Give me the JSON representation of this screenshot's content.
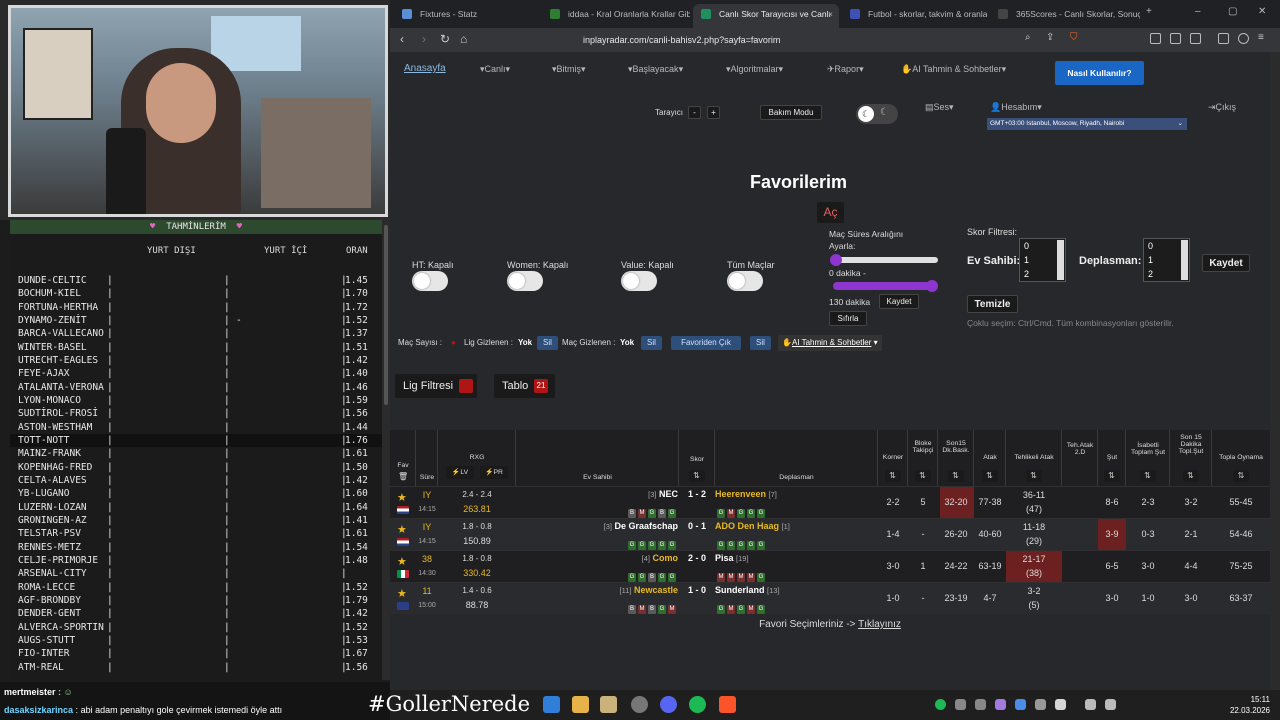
{
  "predictions": {
    "header": "TAHMİNLERİM",
    "col_away": "YURT DIŞI",
    "col_home": "YURT İÇİ",
    "col_odds": "ORAN",
    "rows": [
      {
        "team": "DUNDE-CELTIC",
        "mid": "",
        "odd": "1.45"
      },
      {
        "team": "BOCHUM-KIEL",
        "mid": "",
        "odd": "1.70"
      },
      {
        "team": "FORTUNA-HERTHA",
        "mid": "",
        "odd": "1.72"
      },
      {
        "team": "DYNAMO-ZENİT",
        "mid": "-",
        "odd": "1.52"
      },
      {
        "team": "BARCA-VALLECANO",
        "mid": "",
        "odd": "1.37"
      },
      {
        "team": "WINTER-BASEL",
        "mid": "",
        "odd": "1.51"
      },
      {
        "team": "UTRECHT-EAGLES",
        "mid": "",
        "odd": "1.42"
      },
      {
        "team": "FEYE-AJAX",
        "mid": "",
        "odd": "1.40"
      },
      {
        "team": "ATALANTA-VERONA",
        "mid": "",
        "odd": "1.46"
      },
      {
        "team": "LYON-MONACO",
        "mid": "",
        "odd": "1.59"
      },
      {
        "team": "SUDTİROL-FROSİ",
        "mid": "",
        "odd": "1.56"
      },
      {
        "team": "ASTON-WESTHAM",
        "mid": "",
        "odd": "1.44"
      },
      {
        "team": "TOTT-NOTT",
        "mid": "",
        "odd": "1.76"
      },
      {
        "team": "MAINZ-FRANK",
        "mid": "",
        "odd": "1.61"
      },
      {
        "team": "KOPENHAG-FRED",
        "mid": "",
        "odd": "1.50"
      },
      {
        "team": "CELTA-ALAVES",
        "mid": "",
        "odd": "1.42"
      },
      {
        "team": "YB-LUGANO",
        "mid": "",
        "odd": "1.60"
      },
      {
        "team": "LUZERN-LOZAN",
        "mid": "",
        "odd": "1.64"
      },
      {
        "team": "GRONINGEN-AZ",
        "mid": "",
        "odd": "1.41"
      },
      {
        "team": "TELSTAR-PSV",
        "mid": "",
        "odd": "1.61"
      },
      {
        "team": "RENNES-METZ",
        "mid": "",
        "odd": "1.54"
      },
      {
        "team": "CELJE-PRIMORJE",
        "mid": "",
        "odd": "1.48"
      },
      {
        "team": "ARSENAL-CITY",
        "mid": "",
        "odd": ""
      },
      {
        "team": "ROMA-LECCE",
        "mid": "",
        "odd": "1.52"
      },
      {
        "team": "AGF-BRONDBY",
        "mid": "",
        "odd": "1.79"
      },
      {
        "team": "DENDER-GENT",
        "mid": "",
        "odd": "1.42"
      },
      {
        "team": "ALVERCA-SPORTIN",
        "mid": "",
        "odd": "1.52"
      },
      {
        "team": "AUGS-STUTT",
        "mid": "",
        "odd": "1.53"
      },
      {
        "team": "FIO-INTER",
        "mid": "",
        "odd": "1.67"
      },
      {
        "team": "ATM-REAL",
        "mid": "",
        "odd": "1.56"
      }
    ]
  },
  "chat": {
    "user1": "mertmeister",
    "user2": "dasaksizkarinca",
    "msg2": "abi adam penaltıyı gole çevirmek istemedi öyle attı"
  },
  "tabs": [
    {
      "label": "Fixtures - Statz",
      "color": "#5a8fd6"
    },
    {
      "label": "iddaa - Kral Oranlarla Krallar Gib",
      "color": "#2e7d32"
    },
    {
      "label": "Canlı Skor Tarayıcısı ve Canlı",
      "color": "#1e8f5f"
    },
    {
      "label": "Futbol - skorlar, takvim & oranla",
      "color": "#3f51b5"
    },
    {
      "label": "365Scores - Canlı Skorlar, Sonuç",
      "color": "#444"
    }
  ],
  "url": "inplayradar.com/canli-bahisv2.php?sayfa=favorim",
  "menu": {
    "home": "Anasayfa",
    "items": [
      "Canlı",
      "Bitmiş",
      "Başlayacak",
      "Algoritmalar",
      "Rapor",
      "AI Tahmin & Sohbetler"
    ],
    "howto": "Nasıl Kullanılır?",
    "scanner": "Tarayıcı",
    "minus": "-",
    "plus": "+",
    "maint": "Bakım Modu",
    "sound": "Ses",
    "account": "Hesabım",
    "logout": "Çıkış",
    "timezone": "GMT+03:00 Istanbul, Moscow, Riyadh, Nairobi"
  },
  "fav": {
    "title": "Favorilerim",
    "open": "Aç",
    "ht": "HT: Kapalı",
    "women": "Women: Kapalı",
    "value": "Value: Kapalı",
    "all": "Tüm Maçlar",
    "range_title": "Maç Süres Aralığını Ayarla:",
    "min_label": "0 dakika -",
    "max_label": "130 dakika",
    "save": "Kaydet",
    "reset": "Sıfırla",
    "score_filter": "Skor Filtresi:",
    "home_score": "Ev Sahibi:",
    "away_score": "Deplasman:",
    "list_vals": [
      "0",
      "1",
      "2"
    ],
    "save2": "Kaydet",
    "clear": "Temizle",
    "hint": "Çoklu seçim: Ctrl/Cmd. Tüm kombinasyonları gösterilir."
  },
  "filterbar": {
    "count": "Maç Sayısı :",
    "lig_hidden": "Lig Gizlenen :",
    "yok1": "Yok",
    "sil1": "Sil",
    "mac_hidden": "Maç Gizlenen :",
    "yok2": "Yok",
    "sil2": "Sil",
    "fav_out": "Favoriden Çık",
    "sil3": "Sil",
    "ai": "AI Tahmin & Sohbetler"
  },
  "buttons": {
    "lig": "Lig Filtresi",
    "tablo": "Tablo",
    "tablo_count": "21"
  },
  "table": {
    "headers": {
      "fav": "Fav",
      "sure": "Süre",
      "rxg": "RXG",
      "lv": "LV",
      "pr": "PR",
      "home": "Ev Sahibi",
      "score": "Skor",
      "away": "Deplasman",
      "corner": "Korner",
      "block": "Bloke Takipçi",
      "son15": "Son15 Dk.Bask.",
      "atak": "Atak",
      "tehlikeli": "Tehlikeli Atak",
      "tehatak": "Teh.Atak 2.D",
      "sut": "Şut",
      "isabetli": "İsabetli Toplam Şut",
      "son15sut": "Son 15 Dakika Topl.Şut",
      "topla": "Topla Oynama"
    },
    "rows": [
      {
        "min": "IY",
        "time": "14:15",
        "rxg": "2.4 - 2.4",
        "pr": "263.81",
        "home": "NEC",
        "hrank": "[3]",
        "score": "1 - 2",
        "away": "Heerenveen",
        "arank": "[7]",
        "hchips": [
          "B",
          "M",
          "G",
          "B",
          "G"
        ],
        "achips": [
          "G",
          "M",
          "G",
          "G",
          "G"
        ],
        "korner": "2-2",
        "bloke": "5",
        "son15": "32-20",
        "atak": "77-38",
        "tehl": "36-11",
        "tehl2": "(47)",
        "sut": "8-6",
        "isab": "2-3",
        "s15": "3-2",
        "topla": "55-45",
        "flag": "nl"
      },
      {
        "min": "IY",
        "time": "14:15",
        "rxg": "1.8 - 0.8",
        "pr": "150.89",
        "home": "De Graafschap",
        "hrank": "[3]",
        "score": "0 - 1",
        "away": "ADO Den Haag",
        "arank": "[1]",
        "hchips": [
          "G",
          "G",
          "G",
          "G",
          "G"
        ],
        "achips": [
          "G",
          "G",
          "G",
          "G",
          "G"
        ],
        "korner": "1-4",
        "bloke": "-",
        "son15": "26-20",
        "atak": "40-60",
        "tehl": "11-18",
        "tehl2": "(29)",
        "sut": "3-9",
        "isab": "0-3",
        "s15": "2-1",
        "topla": "54-46",
        "flag": "nl"
      },
      {
        "min": "38",
        "time": "14:30",
        "rxg": "1.8 - 0.8",
        "pr": "330.42",
        "home": "Como",
        "hrank": "[4]",
        "score": "2 - 0",
        "away": "Pisa",
        "arank": "[19]",
        "hchips": [
          "G",
          "G",
          "B",
          "G",
          "G"
        ],
        "achips": [
          "M",
          "M",
          "M",
          "M",
          "G"
        ],
        "korner": "3-0",
        "bloke": "1",
        "son15": "24-22",
        "atak": "63-19",
        "tehl": "21-17",
        "tehl2": "(38)",
        "sut": "6-5",
        "isab": "3-0",
        "s15": "4-4",
        "topla": "75-25",
        "flag": "it"
      },
      {
        "min": "11",
        "time": "15:00",
        "rxg": "1.4 - 0.6",
        "pr": "88.78",
        "home": "Newcastle",
        "hrank": "[11]",
        "score": "1 - 0",
        "away": "Sunderland",
        "arank": "[13]",
        "hchips": [
          "B",
          "M",
          "B",
          "G",
          "M"
        ],
        "achips": [
          "G",
          "M",
          "G",
          "M",
          "G"
        ],
        "korner": "1-0",
        "bloke": "-",
        "son15": "23-19",
        "atak": "4-7",
        "tehl": "3-2",
        "tehl2": "(5)",
        "sut": "3-0",
        "isab": "1-0",
        "s15": "3-0",
        "topla": "63-37",
        "flag": "uk"
      }
    ]
  },
  "footer": {
    "text": "Favori Seçimleriniz ->",
    "link": "Tıklayınız"
  },
  "taskbar": {
    "hashtag": "#GollerNerede",
    "time": "15:11",
    "date": "22.03.2026"
  }
}
